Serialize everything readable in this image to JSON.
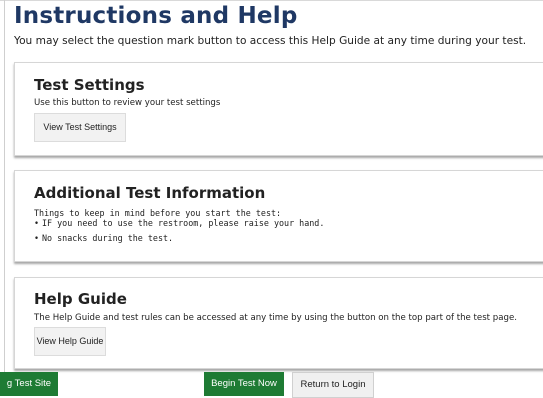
{
  "header": {
    "title": "Instructions and Help",
    "subtitle": "You may select the question mark button to access this Help Guide at any time during your test."
  },
  "sections": [
    {
      "title": "Test Settings",
      "text": "Use this button to review your test settings",
      "button_label": "View Test Settings"
    },
    {
      "title": "Additional Test Information",
      "intro": "Things to keep in mind before you start the test:",
      "bullets": [
        "IF you need to use the restroom, please raise your hand.",
        "No snacks during the test."
      ]
    },
    {
      "title": "Help Guide",
      "text": "The Help Guide and test rules can be accessed at any time by using the button on the top part of the test page.",
      "button_label": "View Help Guide"
    }
  ],
  "footer": {
    "left_button": "g Test Site",
    "begin_button": "Begin Test Now",
    "return_button": "Return to Login"
  },
  "colors": {
    "title": "#1f3864",
    "primary_button": "#1e7b34"
  }
}
